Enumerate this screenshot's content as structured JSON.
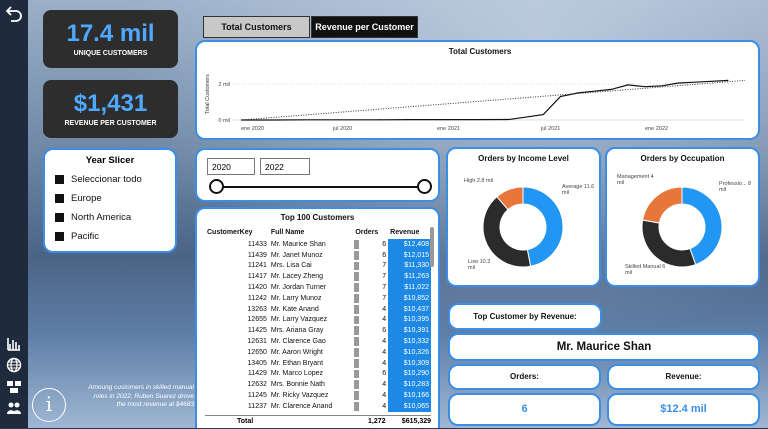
{
  "kpis": {
    "unique_customers_value": "17.4 mil",
    "unique_customers_label": "UNIQUE CUSTOMERS",
    "revenue_per_customer_value": "$1,431",
    "revenue_per_customer_label": "REVENUE PER CUSTOMER"
  },
  "tabs": {
    "total_customers": "Total Customers",
    "revenue_per_customer": "Revenue per Customer"
  },
  "line_chart": {
    "title": "Total Customers",
    "ylabel": "Total Customers",
    "yticks": [
      "2 mil",
      "0 mil"
    ],
    "xticks": [
      "ene 2020",
      "jul 2020",
      "ene 2021",
      "jul 2021",
      "ene 2022"
    ]
  },
  "chart_data": [
    {
      "type": "line",
      "title": "Total Customers",
      "ylabel": "Total Customers",
      "x": [
        "2020-01",
        "2020-03",
        "2020-05",
        "2020-07",
        "2020-09",
        "2020-11",
        "2021-01",
        "2021-03",
        "2021-05",
        "2021-07",
        "2021-08",
        "2021-09",
        "2021-10",
        "2021-11",
        "2021-12",
        "2022-01",
        "2022-02",
        "2022-03",
        "2022-04",
        "2022-05",
        "2022-06"
      ],
      "series": [
        {
          "values": [
            0.0,
            0.0,
            0.01,
            0.01,
            0.01,
            0.02,
            0.02,
            0.02,
            0.03,
            0.3,
            1.3,
            1.5,
            1.6,
            1.7,
            1.95,
            1.85,
            1.9,
            2.05,
            2.1,
            2.15,
            2.2
          ]
        }
      ],
      "trendline": "dotted",
      "ylim": [
        0,
        2.5
      ]
    },
    {
      "type": "pie",
      "title": "Orders by Income Level",
      "categories": [
        "Average",
        "Low",
        "High"
      ],
      "values": [
        11.6,
        10.3,
        2.8
      ],
      "labels": [
        "Average 11.6 mil",
        "Low 10.3 mil",
        "High 2.8 mil"
      ]
    },
    {
      "type": "pie",
      "title": "Orders by Occupation",
      "categories": [
        "Professio...",
        "Skilled Manual",
        "Management"
      ],
      "values": [
        8,
        6,
        4
      ],
      "labels": [
        "Professio... 8 mil",
        "Skilled Manual 6 mil",
        "Management 4 mil"
      ]
    }
  ],
  "year_slicer": {
    "title": "Year Slicer",
    "options": [
      "Seleccionar todo",
      "Europe",
      "North America",
      "Pacific"
    ]
  },
  "range_slicer": {
    "start": "2020",
    "end": "2022"
  },
  "table": {
    "title": "Top 100 Customers",
    "headers": [
      "CustomerKey",
      "Full Name",
      "Orders",
      "Revenue"
    ],
    "rows": [
      [
        "11433",
        "Mr. Maurice Shan",
        "6",
        "$12,408"
      ],
      [
        "11439",
        "Mr. Janet Munoz",
        "6",
        "$12,015"
      ],
      [
        "11241",
        "Mrs. Lisa Cai",
        "7",
        "$11,330"
      ],
      [
        "11417",
        "Mr. Lacey Zheng",
        "7",
        "$11,263"
      ],
      [
        "11420",
        "Mr. Jordan Turner",
        "7",
        "$11,022"
      ],
      [
        "11242",
        "Mr. Larry Munoz",
        "7",
        "$10,852"
      ],
      [
        "13263",
        "Mr. Kate Anand",
        "4",
        "$10,437"
      ],
      [
        "12655",
        "Mr. Larry Vazquez",
        "4",
        "$10,395"
      ],
      [
        "11425",
        "Mrs. Ariana Gray",
        "6",
        "$10,391"
      ],
      [
        "12631",
        "Mr. Clarence Gao",
        "4",
        "$10,332"
      ],
      [
        "12650",
        "Mr. Aaron Wright",
        "4",
        "$10,326"
      ],
      [
        "13405",
        "Mr. Ethan Bryant",
        "4",
        "$10,309"
      ],
      [
        "11429",
        "Mr. Marco Lopez",
        "6",
        "$10,290"
      ],
      [
        "12632",
        "Mrs. Bonnie Nath",
        "4",
        "$10,283"
      ],
      [
        "11245",
        "Mr. Ricky Vazquez",
        "4",
        "$10,166"
      ],
      [
        "11237",
        "Mr. Clarence Anand",
        "4",
        "$10,065"
      ]
    ],
    "total_label": "Total",
    "total_orders": "1,272",
    "total_revenue": "$615,329"
  },
  "top_customer": {
    "header": "Top Customer by Revenue:",
    "name": "Mr. Maurice Shan",
    "orders_label": "Orders:",
    "orders_value": "6",
    "revenue_label": "Revenue:",
    "revenue_value": "$12.4 mil"
  },
  "footnote": "Amoung customers in skilled manual roles in 2022, Ruben Suarez drove the most revenue at $4683",
  "info_glyph": "i",
  "nav_icons": [
    "back-arrow-icon",
    "bar-chart-icon",
    "globe-icon",
    "boxes-icon",
    "people-icon"
  ],
  "colors": {
    "accent_blue": "#1e88e5",
    "kpi_blue": "#4fa9ff",
    "donut_orange": "#e8753a",
    "donut_dark": "#2b2b2b",
    "donut_blue": "#2196f3"
  }
}
